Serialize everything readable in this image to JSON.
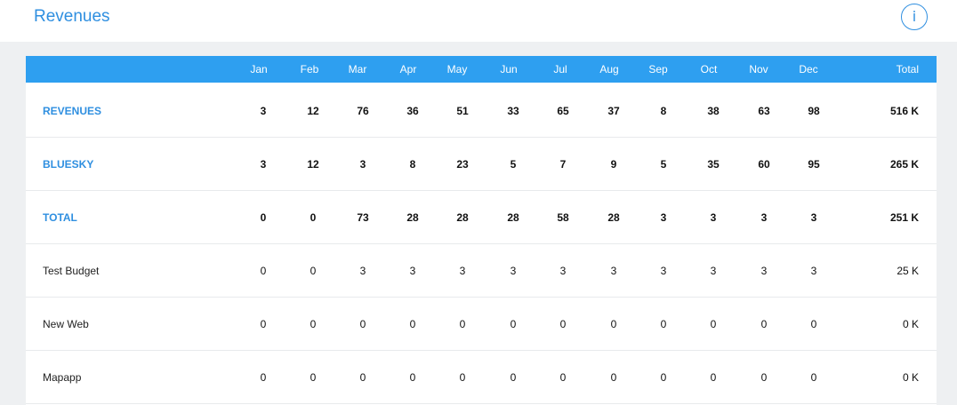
{
  "header": {
    "title": "Revenues",
    "info_label": "i"
  },
  "table": {
    "months": [
      "Jan",
      "Feb",
      "Mar",
      "Apr",
      "May",
      "Jun",
      "Jul",
      "Aug",
      "Sep",
      "Oct",
      "Nov",
      "Dec"
    ],
    "total_label": "Total",
    "rows": [
      {
        "label": "REVENUES",
        "bold": true,
        "values": [
          "3",
          "12",
          "76",
          "36",
          "51",
          "33",
          "65",
          "37",
          "8",
          "38",
          "63",
          "98"
        ],
        "total": "516 K"
      },
      {
        "label": "BLUESKY",
        "bold": true,
        "values": [
          "3",
          "12",
          "3",
          "8",
          "23",
          "5",
          "7",
          "9",
          "5",
          "35",
          "60",
          "95"
        ],
        "total": "265 K"
      },
      {
        "label": "TOTAL",
        "bold": true,
        "values": [
          "0",
          "0",
          "73",
          "28",
          "28",
          "28",
          "58",
          "28",
          "3",
          "3",
          "3",
          "3"
        ],
        "total": "251 K"
      },
      {
        "label": "Test Budget",
        "bold": false,
        "values": [
          "0",
          "0",
          "3",
          "3",
          "3",
          "3",
          "3",
          "3",
          "3",
          "3",
          "3",
          "3"
        ],
        "total": "25 K"
      },
      {
        "label": "New Web",
        "bold": false,
        "values": [
          "0",
          "0",
          "0",
          "0",
          "0",
          "0",
          "0",
          "0",
          "0",
          "0",
          "0",
          "0"
        ],
        "total": "0 K"
      },
      {
        "label": "Mapapp",
        "bold": false,
        "values": [
          "0",
          "0",
          "0",
          "0",
          "0",
          "0",
          "0",
          "0",
          "0",
          "0",
          "0",
          "0"
        ],
        "total": "0 K"
      }
    ]
  },
  "colors": {
    "accent": "#2f8fe0",
    "header_bg": "#2e9ff0",
    "page_bg": "#eef0f2"
  }
}
